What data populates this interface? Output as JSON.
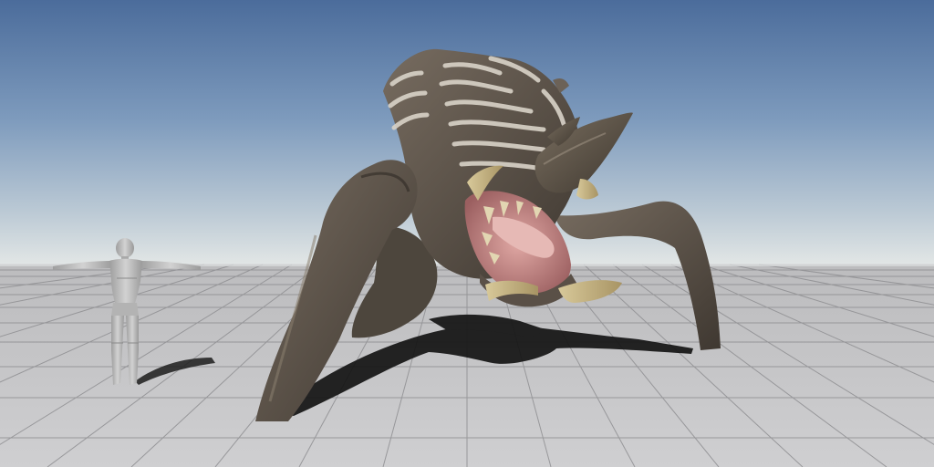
{
  "scene": {
    "sky_top_color": "#4d6f9e",
    "sky_horizon_color": "#dfe4e3",
    "floor_color": "#c4c4c6",
    "grid_line_color": "#8e8e90",
    "creature_skin_color": "#5b5248",
    "creature_stripe_color": "#d6d0c5",
    "creature_horn_color": "#c9b98a",
    "creature_mouth_color": "#c98f8f",
    "mannequin_color": "#bdbdbd"
  }
}
